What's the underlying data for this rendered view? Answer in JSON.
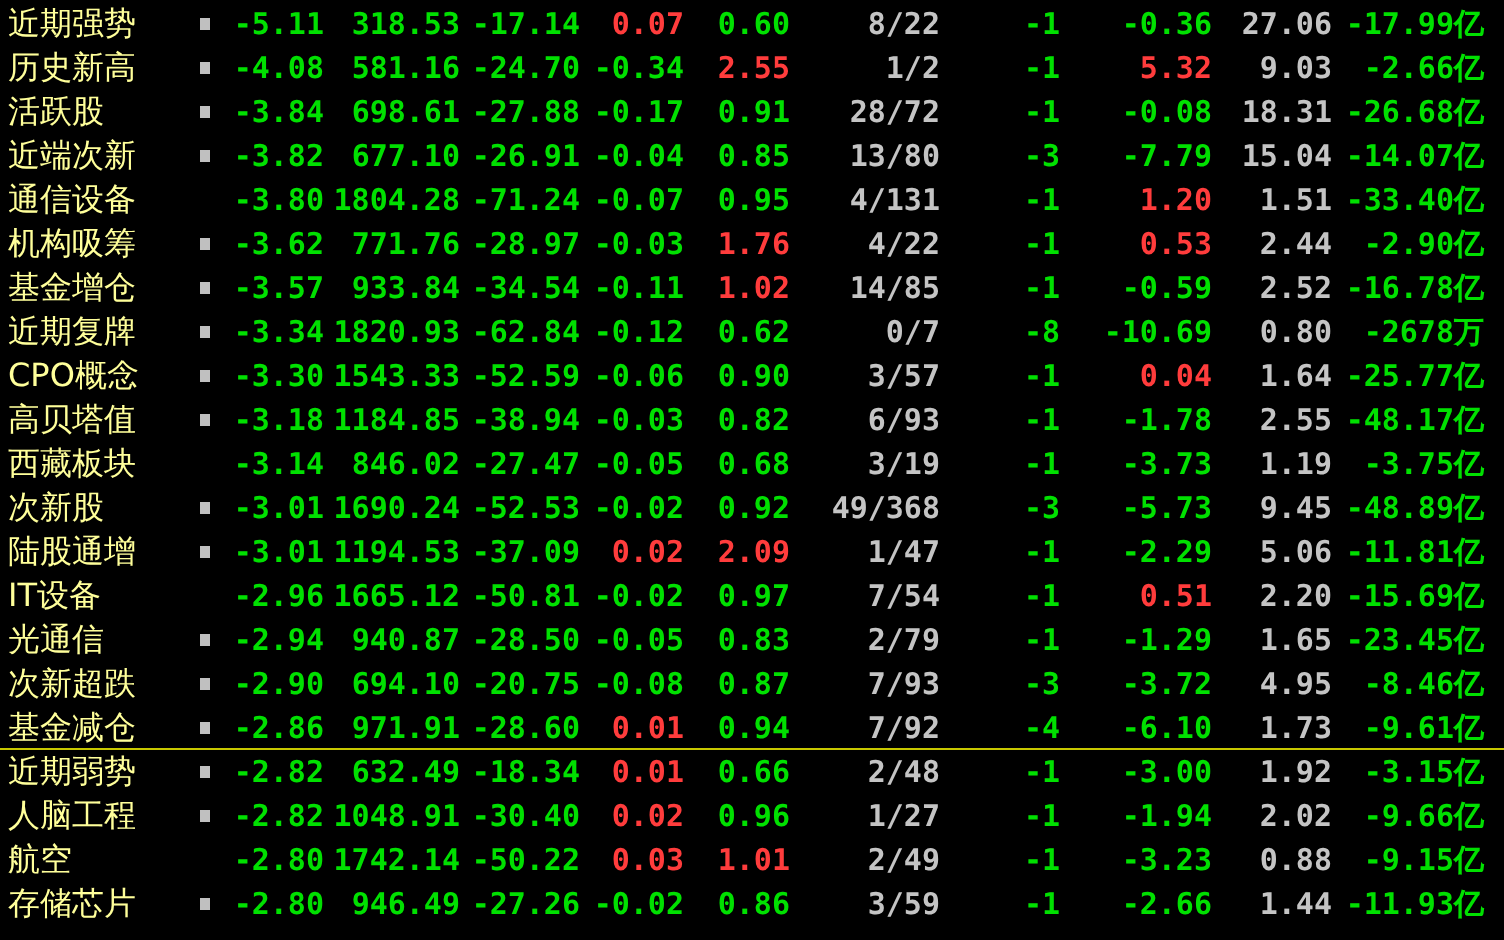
{
  "rows": [
    {
      "name": "近期强势",
      "marked": true,
      "divider_below": false,
      "cells": [
        "-5.11",
        "318.53",
        "-17.14",
        "0.07",
        "0.60",
        "8/22",
        "-1",
        "-0.36",
        "27.06",
        "-17.99亿"
      ],
      "up": [
        true,
        false,
        false
      ]
    },
    {
      "name": "历史新高",
      "marked": true,
      "divider_below": false,
      "cells": [
        "-4.08",
        "581.16",
        "-24.70",
        "-0.34",
        "2.55",
        "1/2",
        "-1",
        "5.32",
        "9.03",
        "-2.66亿"
      ],
      "up": [
        false,
        true,
        true
      ]
    },
    {
      "name": "活跃股",
      "marked": true,
      "divider_below": false,
      "cells": [
        "-3.84",
        "698.61",
        "-27.88",
        "-0.17",
        "0.91",
        "28/72",
        "-1",
        "-0.08",
        "18.31",
        "-26.68亿"
      ],
      "up": [
        false,
        false,
        false
      ]
    },
    {
      "name": "近端次新",
      "marked": true,
      "divider_below": false,
      "cells": [
        "-3.82",
        "677.10",
        "-26.91",
        "-0.04",
        "0.85",
        "13/80",
        "-3",
        "-7.79",
        "15.04",
        "-14.07亿"
      ],
      "up": [
        false,
        false,
        false
      ]
    },
    {
      "name": "通信设备",
      "marked": false,
      "divider_below": false,
      "cells": [
        "-3.80",
        "1804.28",
        "-71.24",
        "-0.07",
        "0.95",
        "4/131",
        "-1",
        "1.20",
        "1.51",
        "-33.40亿"
      ],
      "up": [
        false,
        false,
        true
      ]
    },
    {
      "name": "机构吸筹",
      "marked": true,
      "divider_below": false,
      "cells": [
        "-3.62",
        "771.76",
        "-28.97",
        "-0.03",
        "1.76",
        "4/22",
        "-1",
        "0.53",
        "2.44",
        "-2.90亿"
      ],
      "up": [
        false,
        true,
        true
      ]
    },
    {
      "name": "基金增仓",
      "marked": true,
      "divider_below": false,
      "cells": [
        "-3.57",
        "933.84",
        "-34.54",
        "-0.11",
        "1.02",
        "14/85",
        "-1",
        "-0.59",
        "2.52",
        "-16.78亿"
      ],
      "up": [
        false,
        true,
        false
      ]
    },
    {
      "name": "近期复牌",
      "marked": true,
      "divider_below": false,
      "cells": [
        "-3.34",
        "1820.93",
        "-62.84",
        "-0.12",
        "0.62",
        "0/7",
        "-8",
        "-10.69",
        "0.80",
        "-2678万"
      ],
      "up": [
        false,
        false,
        false
      ]
    },
    {
      "name": "CPO概念",
      "marked": true,
      "divider_below": false,
      "cells": [
        "-3.30",
        "1543.33",
        "-52.59",
        "-0.06",
        "0.90",
        "3/57",
        "-1",
        "0.04",
        "1.64",
        "-25.77亿"
      ],
      "up": [
        false,
        false,
        true
      ]
    },
    {
      "name": "高贝塔值",
      "marked": true,
      "divider_below": false,
      "cells": [
        "-3.18",
        "1184.85",
        "-38.94",
        "-0.03",
        "0.82",
        "6/93",
        "-1",
        "-1.78",
        "2.55",
        "-48.17亿"
      ],
      "up": [
        false,
        false,
        false
      ]
    },
    {
      "name": "西藏板块",
      "marked": false,
      "divider_below": false,
      "cells": [
        "-3.14",
        "846.02",
        "-27.47",
        "-0.05",
        "0.68",
        "3/19",
        "-1",
        "-3.73",
        "1.19",
        "-3.75亿"
      ],
      "up": [
        false,
        false,
        false
      ]
    },
    {
      "name": "次新股",
      "marked": true,
      "divider_below": false,
      "cells": [
        "-3.01",
        "1690.24",
        "-52.53",
        "-0.02",
        "0.92",
        "49/368",
        "-3",
        "-5.73",
        "9.45",
        "-48.89亿"
      ],
      "up": [
        false,
        false,
        false
      ]
    },
    {
      "name": "陆股通增",
      "marked": true,
      "divider_below": false,
      "cells": [
        "-3.01",
        "1194.53",
        "-37.09",
        "0.02",
        "2.09",
        "1/47",
        "-1",
        "-2.29",
        "5.06",
        "-11.81亿"
      ],
      "up": [
        true,
        true,
        false
      ]
    },
    {
      "name": "IT设备",
      "marked": false,
      "divider_below": false,
      "cells": [
        "-2.96",
        "1665.12",
        "-50.81",
        "-0.02",
        "0.97",
        "7/54",
        "-1",
        "0.51",
        "2.20",
        "-15.69亿"
      ],
      "up": [
        false,
        false,
        true
      ]
    },
    {
      "name": "光通信",
      "marked": true,
      "divider_below": false,
      "cells": [
        "-2.94",
        "940.87",
        "-28.50",
        "-0.05",
        "0.83",
        "2/79",
        "-1",
        "-1.29",
        "1.65",
        "-23.45亿"
      ],
      "up": [
        false,
        false,
        false
      ]
    },
    {
      "name": "次新超跌",
      "marked": true,
      "divider_below": false,
      "cells": [
        "-2.90",
        "694.10",
        "-20.75",
        "-0.08",
        "0.87",
        "7/93",
        "-3",
        "-3.72",
        "4.95",
        "-8.46亿"
      ],
      "up": [
        false,
        false,
        false
      ]
    },
    {
      "name": "基金减仓",
      "marked": true,
      "divider_below": true,
      "cells": [
        "-2.86",
        "971.91",
        "-28.60",
        "0.01",
        "0.94",
        "7/92",
        "-4",
        "-6.10",
        "1.73",
        "-9.61亿"
      ],
      "up": [
        true,
        false,
        false
      ]
    },
    {
      "name": "近期弱势",
      "marked": true,
      "divider_below": false,
      "cells": [
        "-2.82",
        "632.49",
        "-18.34",
        "0.01",
        "0.66",
        "2/48",
        "-1",
        "-3.00",
        "1.92",
        "-3.15亿"
      ],
      "up": [
        true,
        false,
        false
      ]
    },
    {
      "name": "人脑工程",
      "marked": true,
      "divider_below": false,
      "cells": [
        "-2.82",
        "1048.91",
        "-30.40",
        "0.02",
        "0.96",
        "1/27",
        "-1",
        "-1.94",
        "2.02",
        "-9.66亿"
      ],
      "up": [
        true,
        false,
        false
      ]
    },
    {
      "name": "航空",
      "marked": false,
      "divider_below": false,
      "cells": [
        "-2.80",
        "1742.14",
        "-50.22",
        "0.03",
        "1.01",
        "2/49",
        "-1",
        "-3.23",
        "0.88",
        "-9.15亿"
      ],
      "up": [
        true,
        true,
        false
      ]
    },
    {
      "name": "存储芯片",
      "marked": true,
      "divider_below": false,
      "cells": [
        "-2.80",
        "946.49",
        "-27.26",
        "-0.02",
        "0.86",
        "3/59",
        "-1",
        "-2.66",
        "1.44",
        "-11.93亿"
      ],
      "up": [
        false,
        false,
        false
      ]
    }
  ]
}
